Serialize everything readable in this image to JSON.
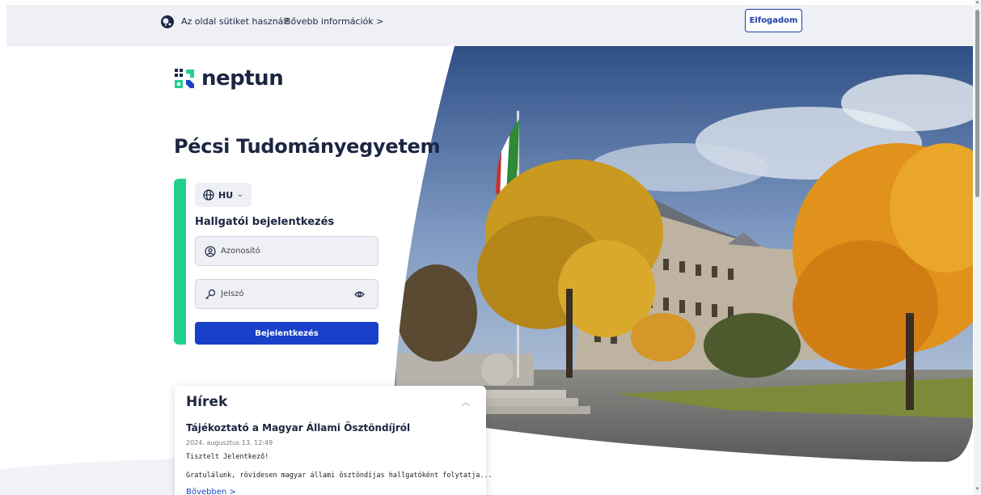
{
  "cookie_bar": {
    "text": "Az oldal sütiket használ!",
    "more_link": "Bővebb információk >",
    "accept_label": "Elfogadom"
  },
  "brand": {
    "name": "neptun",
    "university": "Pécsi Tudományegyetem",
    "colors": {
      "navy": "#1c2541",
      "accent_green": "#22d08c",
      "primary_blue": "#1741c8"
    }
  },
  "login": {
    "language": "HU",
    "heading": "Hallgatói bejelentkezés",
    "username_placeholder": "Azonosító",
    "password_placeholder": "Jelszó",
    "submit_label": "Bejelentkezés",
    "icons": [
      "globe-icon",
      "chevron-down-icon",
      "user-circle-icon",
      "key-icon",
      "eye-icon"
    ]
  },
  "news": {
    "title": "Hírek",
    "articles": [
      {
        "title": "Tájékoztató a Magyar Állami Ösztöndíjról",
        "date": "2024. augusztus 13. 12:49",
        "greeting": "Tisztelt Jelentkező!",
        "body": "Gratulálunk, rövidesen magyar állami ösztöndíjas hallgatóként folytatja...",
        "more_label": "Bővebben >"
      }
    ]
  }
}
